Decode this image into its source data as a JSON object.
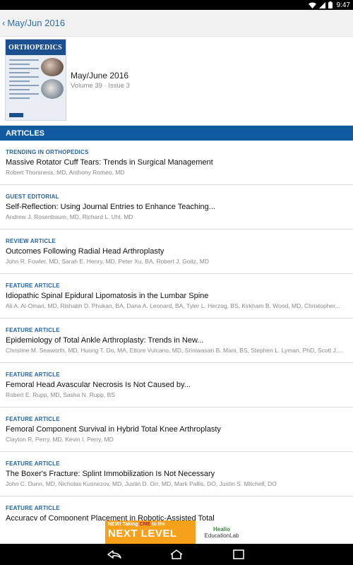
{
  "status_bar": {
    "time": "9:47",
    "icons": [
      "wifi-icon",
      "signal-icon",
      "battery-icon"
    ]
  },
  "app_bar": {
    "back_label": "May/Jun 2016",
    "accent": "#2b6fb3"
  },
  "issue": {
    "cover_logo": "ORTHOPEDICS",
    "title": "May/June 2016",
    "subtitle": "Volume 39 · Issue 3"
  },
  "section": {
    "label": "ARTICLES",
    "color": "#125aa0"
  },
  "articles": [
    {
      "category": "TRENDING IN ORTHOPEDICS",
      "title": "Massive Rotator Cuff Tears: Trends in Surgical Management",
      "authors": "Robert Thorsness, MD, Anthony Romeo, MD"
    },
    {
      "category": "GUEST EDITORIAL",
      "title": "Self-Reflection: Using Journal Entries to Enhance Teaching...",
      "authors": "Andrew J. Rosenbaum, MD, Richard L. Uhl, MD"
    },
    {
      "category": "REVIEW ARTICLE",
      "title": "Outcomes Following Radial Head Arthroplasty",
      "authors": "John R. Fowler, MD, Sarah E. Henry, MD, Peter Xu, BA, Robert J. Goitz, MD"
    },
    {
      "category": "FEATURE ARTICLE",
      "title": "Idiopathic Spinal Epidural Lipomatosis in the Lumbar Spine",
      "authors": "Ali A. Al-Omari, MD, Rishabh D. Phukan, BA, Dana A. Leonard, BA, Tyler L. Herzog, BS, Kirkham B. Wood, MD, Christopher..."
    },
    {
      "category": "FEATURE ARTICLE",
      "title": "Epidemiology of Total Ankle Arthroplasty: Trends in New...",
      "authors": "Christine M. Seaworth, MD, Huong T. Do, MA, Ettore Vulcano, MD, Sriniwasan B. Mani, BS, Stephen L. Lyman, PhD, Scott J...."
    },
    {
      "category": "FEATURE ARTICLE",
      "title": "Femoral Head Avascular Necrosis Is Not Caused by...",
      "authors": "Robert E. Rupp, MD, Sasha N. Rupp, BS"
    },
    {
      "category": "FEATURE ARTICLE",
      "title": "Femoral Component Survival in Hybrid Total Knee Arthroplasty",
      "authors": "Clayton R. Perry, MD, Kevin I. Perry, MD"
    },
    {
      "category": "FEATURE ARTICLE",
      "title": "The Boxer's Fracture: Splint Immobilization Is Not Necessary",
      "authors": "John C. Dunn, MD, Nicholas Kusnezov, MD, Justin D. Orr, MD, Mark Pallis, DO, Justin S. Mitchell, DO"
    },
    {
      "category": "FEATURE ARTICLE",
      "title": "Accuracy of Component Placement in Robotic-Assisted Total",
      "authors": ""
    }
  ],
  "ad": {
    "line1_prefix": "NEW! Taking ",
    "line1_highlight": "CME",
    "line1_suffix": " to the",
    "line2": "NEXT LEVEL",
    "brand": "Healio",
    "brand_sub": "EducationLab"
  },
  "nav": {
    "icons": [
      "back-nav-icon",
      "home-nav-icon",
      "recents-nav-icon"
    ]
  }
}
